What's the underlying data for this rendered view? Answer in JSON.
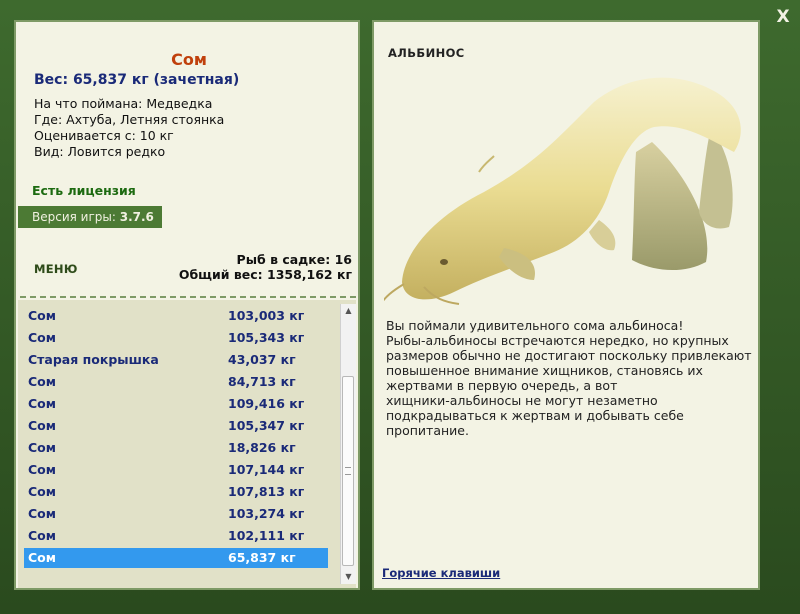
{
  "close_label": "X",
  "fish": {
    "name": "Сом",
    "weight": "Вес: 65,837 кг (зачетная)",
    "bait": "На что поймана: Медведка",
    "location": "Где: Ахтуба, Летняя стоянка",
    "valued_from": "Оценивается с: 10 кг",
    "kind": "Вид: Ловится редко"
  },
  "license": "Есть лицензия",
  "version": {
    "label": "Версия игры:",
    "value": "3.7.6"
  },
  "menu_label": "МЕНЮ",
  "cage": {
    "count_text": "Рыб в садке: 16",
    "total_text": "Общий вес: 1358,162 кг"
  },
  "catch_list": [
    {
      "name": "Сом",
      "weight": "103,003 кг"
    },
    {
      "name": "Сом",
      "weight": "105,343 кг"
    },
    {
      "name": "Старая покрышка",
      "weight": "43,037 кг"
    },
    {
      "name": "Сом",
      "weight": "84,713 кг"
    },
    {
      "name": "Сом",
      "weight": "109,416 кг"
    },
    {
      "name": "Сом",
      "weight": "105,347 кг"
    },
    {
      "name": "Сом",
      "weight": "18,826 кг"
    },
    {
      "name": "Сом",
      "weight": "107,144 кг"
    },
    {
      "name": "Сом",
      "weight": "107,813 кг"
    },
    {
      "name": "Сом",
      "weight": "103,274 кг"
    },
    {
      "name": "Сом",
      "weight": "102,111 кг"
    },
    {
      "name": "Сом",
      "weight": "65,837 кг",
      "selected": true
    }
  ],
  "albino_label": "АЛЬБИНОС",
  "description_lines": [
    "Вы поймали удивительного сома альбиноса!",
    "Рыбы-альбиносы встречаются нередко, но крупных",
    "размеров обычно не достигают поскольку привлекают",
    "повышенное внимание хищников, становясь их",
    "жертвами в первую очередь, а вот",
    "хищники-альбиносы не могут незаметно",
    "подкрадываться к жертвам и добывать себе",
    "пропитание."
  ],
  "hotkeys_label": "Горячие клавиши",
  "icons": {
    "close": "close-icon",
    "scroll_up": "scroll-up-icon",
    "scroll_down": "scroll-down-icon"
  },
  "colors": {
    "frame": "#3a6328",
    "panel": "#f3f3e4",
    "selected": "#3399ee",
    "fish_name": "#c0400c",
    "list_text": "#1a2a78"
  }
}
